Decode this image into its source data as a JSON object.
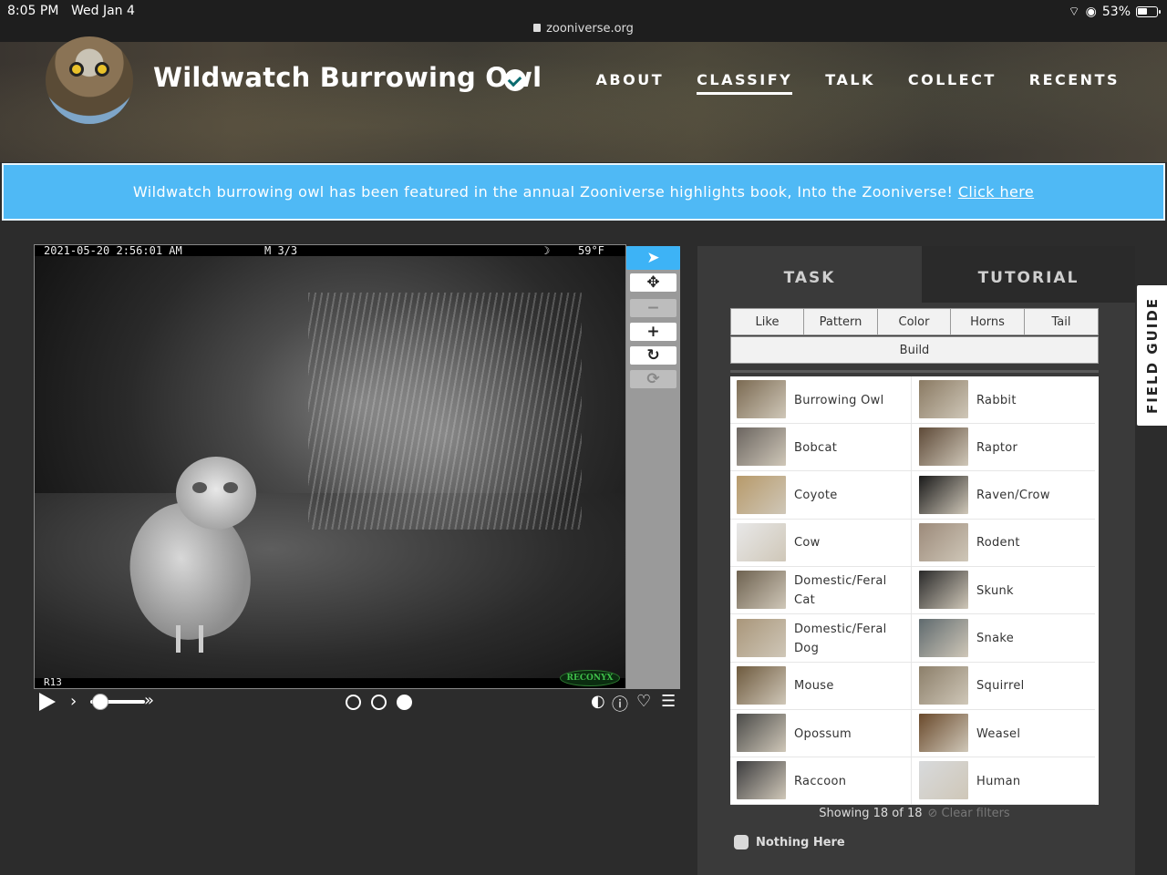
{
  "status_bar": {
    "time": "8:05 PM",
    "date": "Wed Jan 4",
    "url": "zooniverse.org",
    "battery": "53%"
  },
  "header": {
    "title": "Wildwatch Burrowing Owl",
    "nav": [
      {
        "label": "ABOUT",
        "active": false
      },
      {
        "label": "CLASSIFY",
        "active": true
      },
      {
        "label": "TALK",
        "active": false
      },
      {
        "label": "COLLECT",
        "active": false
      },
      {
        "label": "RECENTS",
        "active": false
      }
    ]
  },
  "banner": {
    "text": "Wildwatch burrowing owl has been featured in the annual Zooniverse highlights book, Into the Zooniverse! ",
    "link": "Click here",
    "color": "#4fb9f5"
  },
  "camera": {
    "timestamp": "2021-05-20  2:56:01 AM",
    "sequence": "M 3/3",
    "temperature": "59°F",
    "camera_id": "R13",
    "brand": "RECONYX"
  },
  "toolbar": {
    "icons": [
      "pointer-icon",
      "move-icon",
      "zoom-out-icon",
      "zoom-in-icon",
      "rotate-icon",
      "reset-icon"
    ]
  },
  "controls": {
    "frames": 3,
    "current_frame": 3
  },
  "panel": {
    "tabs": [
      "TASK",
      "TUTORIAL"
    ],
    "filters": [
      "Like",
      "Pattern",
      "Color",
      "Horns",
      "Tail",
      "Build"
    ],
    "choices": [
      {
        "label": "Burrowing Owl",
        "color": "#7b6a52"
      },
      {
        "label": "Rabbit",
        "color": "#8a7a63"
      },
      {
        "label": "Bobcat",
        "color": "#6b6560"
      },
      {
        "label": "Raptor",
        "color": "#5e4a38"
      },
      {
        "label": "Coyote",
        "color": "#b79a6a"
      },
      {
        "label": "Raven/Crow",
        "color": "#1a1a1a"
      },
      {
        "label": "Cow",
        "color": "#e8e8e8"
      },
      {
        "label": "Rodent",
        "color": "#9c8a7a"
      },
      {
        "label": "Domestic/Feral Cat",
        "color": "#6e6250"
      },
      {
        "label": "Skunk",
        "color": "#2a2a2a"
      },
      {
        "label": "Domestic/Feral Dog",
        "color": "#a9967a"
      },
      {
        "label": "Snake",
        "color": "#5f6a6e"
      },
      {
        "label": "Mouse",
        "color": "#6e5a3e"
      },
      {
        "label": "Squirrel",
        "color": "#8c7f6a"
      },
      {
        "label": "Opossum",
        "color": "#4a4a48"
      },
      {
        "label": "Weasel",
        "color": "#6a4a2c"
      },
      {
        "label": "Raccoon",
        "color": "#3c3c3e"
      },
      {
        "label": "Human",
        "color": "#d8dadc"
      }
    ],
    "showing": "Showing 18 of 18",
    "clear_filters": "Clear filters",
    "nothing_here": "Nothing Here"
  },
  "field_guide": "FIELD GUIDE"
}
